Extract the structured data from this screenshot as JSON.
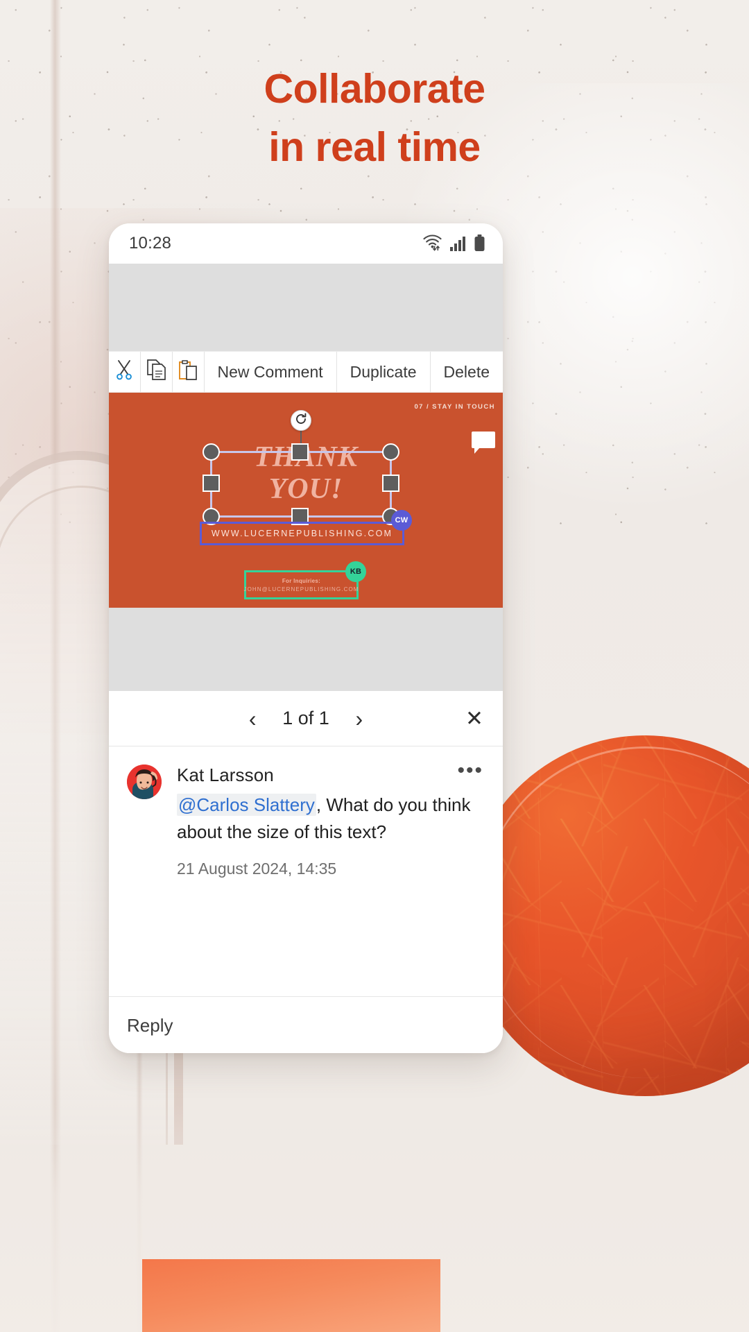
{
  "headline": {
    "line1": "Collaborate",
    "line2": "in real time",
    "color": "#cf3f1c"
  },
  "phone": {
    "statusbar": {
      "time": "10:28",
      "icons": [
        "wifi-icon",
        "cellular-signal-icon",
        "battery-icon"
      ]
    },
    "context_menu": {
      "items": [
        {
          "name": "cut",
          "label": "",
          "icon": "scissors-icon"
        },
        {
          "name": "copy",
          "label": "",
          "icon": "copy-icon"
        },
        {
          "name": "paste",
          "label": "",
          "icon": "paste-icon"
        },
        {
          "name": "new-comment",
          "label": "New Comment",
          "icon": ""
        },
        {
          "name": "duplicate",
          "label": "Duplicate",
          "icon": ""
        },
        {
          "name": "delete",
          "label": "Delete",
          "icon": ""
        }
      ]
    },
    "slide": {
      "background_color": "#c9522e",
      "header": "07  / STAY IN TOUCH",
      "title_line1": "THANK",
      "title_line2": "YOU!",
      "url_text": "WWW.LUCERNEPUBLISHING.COM",
      "inquiries_label": "For Inquiries:",
      "inquiries_email": "JOHN@LUCERNEPUBLISHING.COM",
      "coauthor_blue": {
        "initials": "CW",
        "color": "#5b5bd6"
      },
      "coauthor_green": {
        "initials": "KB",
        "color": "#34d399"
      },
      "rotate_handle": "rotate-icon",
      "comment_marker": "comment-bubble-icon"
    },
    "comment_nav": {
      "prev": "‹",
      "count": "1 of 1",
      "next": "›",
      "close": "✕"
    },
    "comment": {
      "author": "Kat Larsson",
      "mention": "@Carlos Slattery",
      "text": ", What do you think about the size of this text?",
      "timestamp": "21 August 2024, 14:35",
      "more": "•••"
    },
    "reply": {
      "placeholder": "Reply"
    },
    "navbar": {
      "recents": "recents-icon",
      "home": "home-icon",
      "back": "back-icon"
    }
  }
}
